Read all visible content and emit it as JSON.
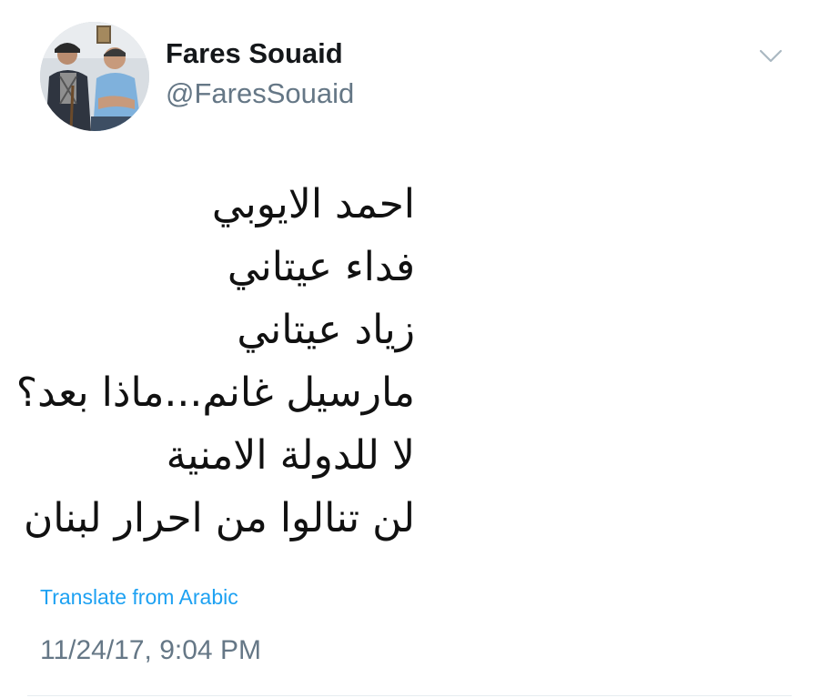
{
  "author": {
    "display_name": "Fares Souaid",
    "handle": "@FaresSouaid",
    "avatar_icon": "profile-photo"
  },
  "menu": {
    "icon": "chevron-down-icon",
    "color": "#aab8c2"
  },
  "tweet": {
    "lines": [
      "احمد الايوبي",
      "فداء عيتاني",
      "زياد عيتاني",
      "مارسيل غانم...ماذا بعد؟",
      "لا للدولة الامنية",
      "لن تنالوا من احرار لبنان"
    ],
    "translate_label": "Translate from Arabic",
    "timestamp": "11/24/17, 9:04 PM"
  },
  "colors": {
    "link": "#1da1f2",
    "secondary_text": "#657786",
    "primary_text": "#14171a",
    "divider": "#e6ecf0"
  }
}
